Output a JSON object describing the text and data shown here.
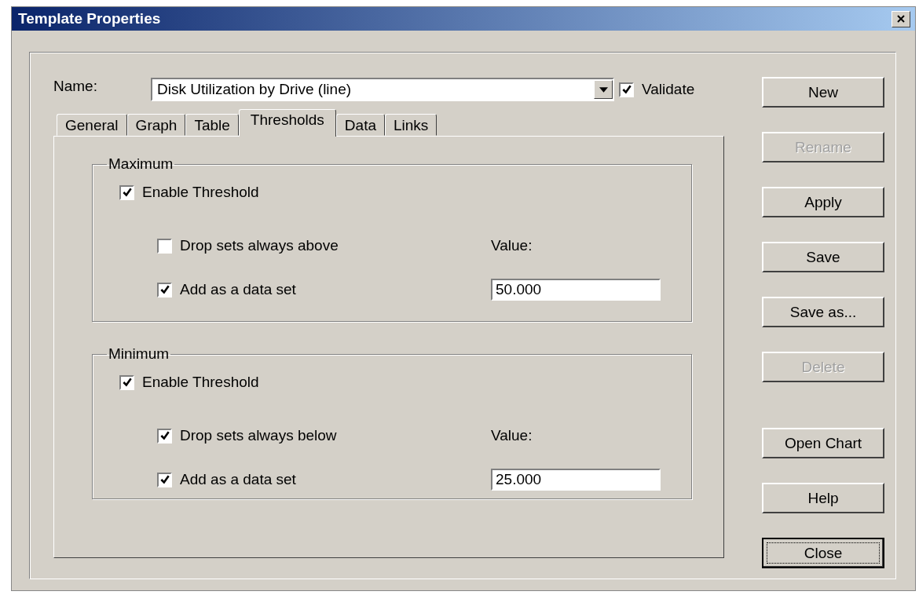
{
  "window": {
    "title": "Template Properties"
  },
  "name_field": {
    "label": "Name:",
    "value": "Disk Utilization by Drive (line)"
  },
  "validate": {
    "label": "Validate",
    "checked": true
  },
  "tabs": [
    {
      "label": "General",
      "selected": false
    },
    {
      "label": "Graph",
      "selected": false
    },
    {
      "label": "Table",
      "selected": false
    },
    {
      "label": "Thresholds",
      "selected": true
    },
    {
      "label": "Data",
      "selected": false
    },
    {
      "label": "Links",
      "selected": false
    }
  ],
  "groups": [
    {
      "title": "Maximum",
      "enable": {
        "label": "Enable Threshold",
        "checked": true
      },
      "drop": {
        "label": "Drop sets always above",
        "checked": false
      },
      "add": {
        "label": "Add as a data set",
        "checked": true
      },
      "value_label": "Value:",
      "value": "50.000"
    },
    {
      "title": "Minimum",
      "enable": {
        "label": "Enable Threshold",
        "checked": true
      },
      "drop": {
        "label": "Drop sets always below",
        "checked": true
      },
      "add": {
        "label": "Add as a data set",
        "checked": true
      },
      "value_label": "Value:",
      "value": "25.000"
    }
  ],
  "buttons": [
    {
      "label": "New",
      "disabled": false,
      "focused": false
    },
    {
      "label": "Rename",
      "disabled": true,
      "focused": false
    },
    {
      "label": "Apply",
      "disabled": false,
      "focused": false
    },
    {
      "label": "Save",
      "disabled": false,
      "focused": false
    },
    {
      "label": "Save as...",
      "disabled": false,
      "focused": false
    },
    {
      "label": "Delete",
      "disabled": true,
      "focused": false
    }
  ],
  "lower_buttons": [
    {
      "label": "Open Chart",
      "disabled": false,
      "focused": false
    },
    {
      "label": "Help",
      "disabled": false,
      "focused": false
    },
    {
      "label": "Close",
      "disabled": false,
      "focused": true
    }
  ]
}
